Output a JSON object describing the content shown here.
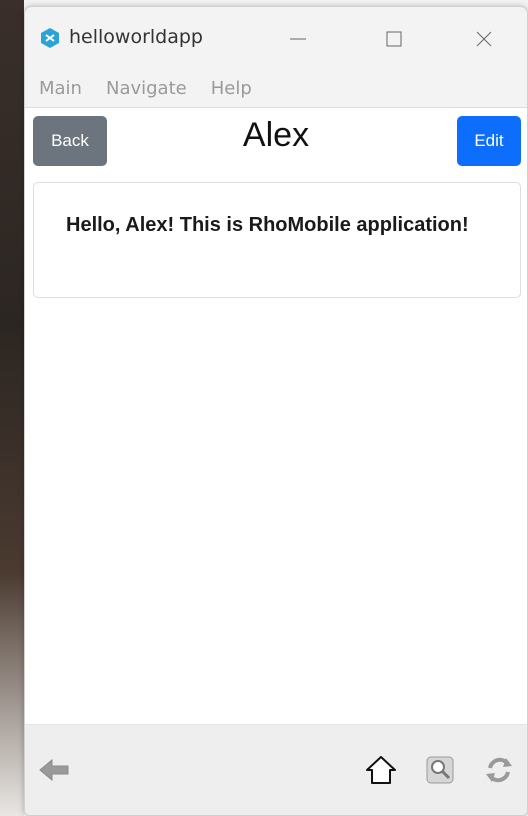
{
  "window": {
    "title": "helloworldapp",
    "icon": "app-logo-icon",
    "controls": [
      "minimize-icon",
      "maximize-icon",
      "close-icon"
    ]
  },
  "menu": {
    "items": [
      "Main",
      "Navigate",
      "Help"
    ]
  },
  "header": {
    "back_label": "Back",
    "title": "Alex",
    "edit_label": "Edit"
  },
  "content": {
    "message": "Hello, Alex! This is RhoMobile application!"
  },
  "toolbar": {
    "icons": [
      "back-arrow-icon",
      "home-icon",
      "search-icon",
      "refresh-icon"
    ]
  },
  "colors": {
    "back_button": "#6c757d",
    "edit_button": "#0d6efd",
    "app_icon": "#2aa3d8"
  }
}
